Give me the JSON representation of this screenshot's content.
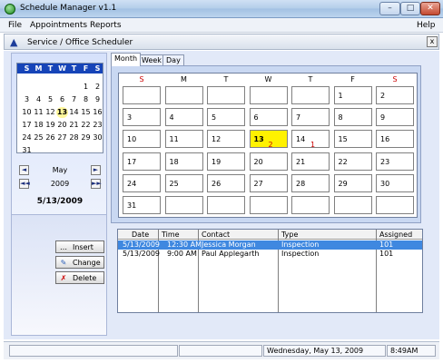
{
  "window": {
    "title": "Schedule Manager  v1.1",
    "min": "–",
    "max": "□",
    "close": "✕"
  },
  "menu": {
    "file": "File",
    "appointments": "Appointments",
    "reports": "Reports",
    "help": "Help"
  },
  "subwindow": {
    "title": "Service / Office Scheduler",
    "close": "x",
    "icon": "▲"
  },
  "mini_calendar": {
    "day_names": [
      "S",
      "M",
      "T",
      "W",
      "T",
      "F",
      "S"
    ],
    "weeks": [
      [
        "",
        "",
        "",
        "",
        "",
        "1",
        "2"
      ],
      [
        "3",
        "4",
        "5",
        "6",
        "7",
        "8",
        "9"
      ],
      [
        "10",
        "11",
        "12",
        "13",
        "14",
        "15",
        "16"
      ],
      [
        "17",
        "18",
        "19",
        "20",
        "21",
        "22",
        "23"
      ],
      [
        "24",
        "25",
        "26",
        "27",
        "28",
        "29",
        "30"
      ],
      [
        "31",
        "",
        "",
        "",
        "",
        "",
        ""
      ]
    ],
    "today": "13"
  },
  "nav": {
    "month": "May",
    "year": "2009",
    "selected_date": "5/13/2009",
    "prev": "◄",
    "next": "►",
    "prev_year": "◄◄",
    "next_year": "►►"
  },
  "actions": {
    "insert": "Insert",
    "change": "Change",
    "delete": "Delete"
  },
  "tabs": {
    "month": "Month",
    "week": "Week",
    "day": "Day",
    "active": "month"
  },
  "calendar": {
    "day_names": [
      "S",
      "M",
      "T",
      "W",
      "T",
      "F",
      "S"
    ],
    "weeks": [
      [
        "",
        "",
        "",
        "",
        "",
        "1",
        "2"
      ],
      [
        "3",
        "4",
        "5",
        "6",
        "7",
        "8",
        "9"
      ],
      [
        "10",
        "11",
        "12",
        "13",
        "14",
        "15",
        "16"
      ],
      [
        "17",
        "18",
        "19",
        "20",
        "21",
        "22",
        "23"
      ],
      [
        "24",
        "25",
        "26",
        "27",
        "28",
        "29",
        "30"
      ],
      [
        "31",
        "",
        "",
        "",
        "",
        "",
        ""
      ]
    ],
    "highlight": "13",
    "counts": {
      "13": "2",
      "14": "1"
    }
  },
  "appointments": {
    "columns": [
      "Date",
      "Time",
      "Contact",
      "Type",
      "Assigned"
    ],
    "rows": [
      [
        "5/13/2009",
        "12:30 AM",
        "Jessica Morgan",
        "Inspection",
        "101"
      ],
      [
        "5/13/2009",
        "9:00 AM",
        "Paul Applegarth",
        "Inspection",
        "101"
      ]
    ],
    "selected_row": 0
  },
  "status": {
    "date": "Wednesday, May 13, 2009",
    "time": "8:49AM"
  },
  "colors": {
    "accent": "#1644b8",
    "highlight": "#fff200",
    "selection": "#3f88e0",
    "weekend_red": "#cc0000"
  }
}
